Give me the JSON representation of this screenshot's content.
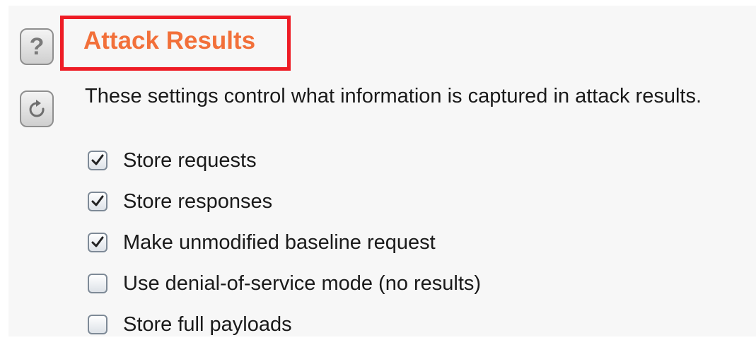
{
  "help_button": {
    "label": "?",
    "icon": "help-icon"
  },
  "reset_button": {
    "icon": "refresh-icon"
  },
  "section": {
    "title": "Attack Results",
    "highlight_color": "#ee1c25",
    "title_color": "#f2703a",
    "description": "These settings control what information is captured in attack results."
  },
  "options": [
    {
      "label": "Store requests",
      "checked": true
    },
    {
      "label": "Store responses",
      "checked": true
    },
    {
      "label": "Make unmodified baseline request",
      "checked": true
    },
    {
      "label": "Use denial-of-service mode (no results)",
      "checked": false
    },
    {
      "label": "Store full payloads",
      "checked": false
    }
  ]
}
